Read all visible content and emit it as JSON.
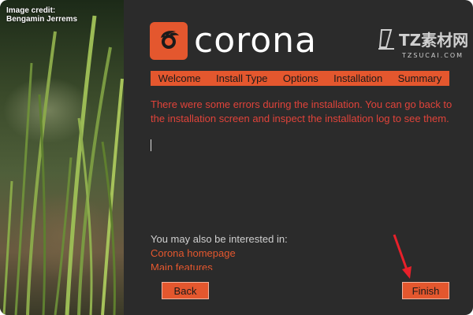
{
  "credit": {
    "line1": "Image credit:",
    "line2": "Bengamin Jerrems"
  },
  "brand": {
    "name": "corona",
    "accent": "#e4572e"
  },
  "watermark": {
    "main": "TZ素材网",
    "sub": "TZSUCAI.COM"
  },
  "steps": [
    "Welcome",
    "Install Type",
    "Options",
    "Installation",
    "Summary"
  ],
  "message": "There were some errors during the installation. You can go back to the installation screen and inspect the installation log to see them.",
  "interest": {
    "label": "You may also be interested in:",
    "links": [
      "Corona homepage",
      "Main features"
    ]
  },
  "buttons": {
    "back": "Back",
    "finish": "Finish"
  }
}
